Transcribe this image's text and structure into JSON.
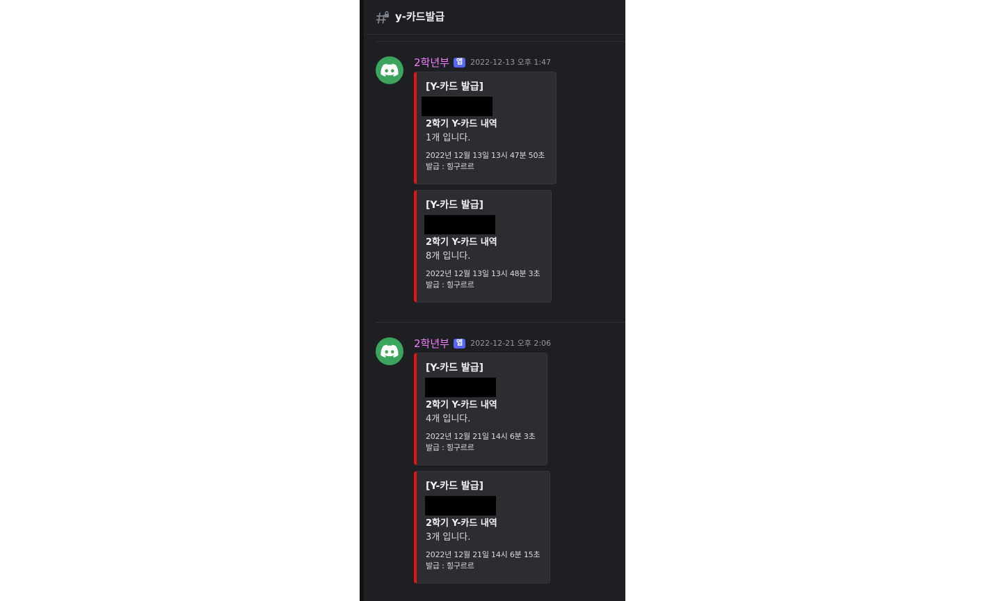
{
  "channel": {
    "name": "y-카드발급",
    "icon": "hash-icon"
  },
  "colors": {
    "background": "#1e1f22",
    "embed_border": "#e41515",
    "author": "#f47fff",
    "badge": "#5865f2",
    "avatar": "#3ba55d"
  },
  "messages": [
    {
      "author": "2학년부",
      "badge": "앱",
      "timestamp": "2022-12-13 오후 1:47",
      "avatar_icon": "discord-logo-icon",
      "embeds": [
        {
          "title": "[Y-카드 발급]",
          "field_name": "2학기 Y-카드 내역",
          "field_value": "1개 입니다.",
          "issued_at": "2022년 12월 13일 13시 47분 50초",
          "issuer": "발급 : 힝구르르"
        },
        {
          "title": "[Y-카드 발급]",
          "field_name": "2학기 Y-카드 내역",
          "field_value": "8개 입니다.",
          "issued_at": "2022년 12월 13일 13시 48분 3초",
          "issuer": "발급 : 힝구르르"
        }
      ]
    },
    {
      "author": "2학년부",
      "badge": "앱",
      "timestamp": "2022-12-21 오후 2:06",
      "avatar_icon": "discord-logo-icon",
      "embeds": [
        {
          "title": "[Y-카드 발급]",
          "field_name": "2학기 Y-카드 내역",
          "field_value": "4개 입니다.",
          "issued_at": "2022년 12월 21일 14시 6분 3초",
          "issuer": "발급 : 힝구르르"
        },
        {
          "title": "[Y-카드 발급]",
          "field_name": "2학기 Y-카드 내역",
          "field_value": "3개 입니다.",
          "issued_at": "2022년 12월 21일 14시 6분 15초",
          "issuer": "발급 : 힝구르르"
        }
      ]
    }
  ]
}
